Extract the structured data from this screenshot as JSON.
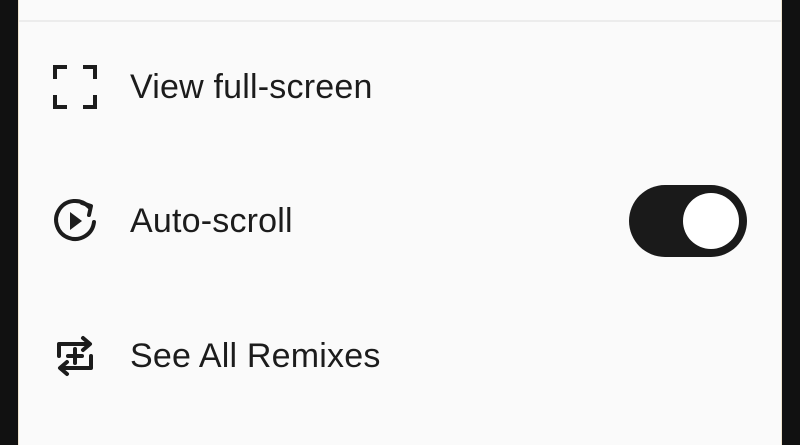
{
  "menu": {
    "items": [
      {
        "label": "View full-screen",
        "icon": "fullscreen-icon"
      },
      {
        "label": "Auto-scroll",
        "icon": "autoplay-icon",
        "toggle": {
          "state": "on"
        }
      },
      {
        "label": "See All Remixes",
        "icon": "remix-icon"
      }
    ]
  },
  "colors": {
    "background": "#fafafa",
    "text": "#1c1c1c",
    "toggle_track": "#1a1a1a",
    "toggle_knob": "#ffffff"
  }
}
